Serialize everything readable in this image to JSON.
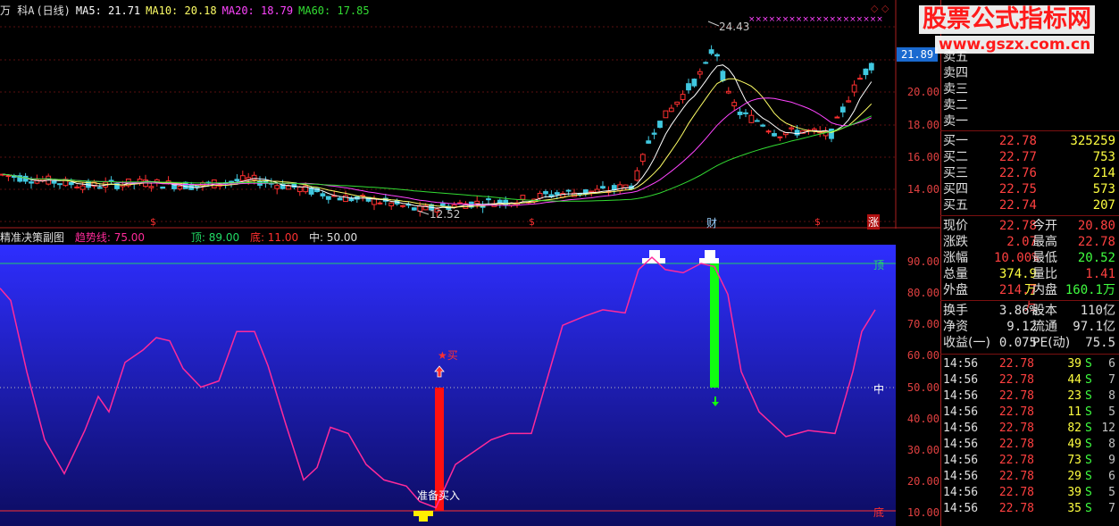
{
  "header": {
    "stock_name": "万 科A",
    "period": "(日线)",
    "ma5": "MA5: 21.71",
    "ma10": "MA10: 20.18",
    "ma20": "MA20: 18.79",
    "ma60": "MA60: 17.85"
  },
  "main_chart": {
    "high_label": "24.43",
    "low_label": "12.52",
    "current_price_tag": "21.89",
    "axis_labels": [
      "20.00",
      "18.00",
      "16.00",
      "14.00"
    ],
    "markers": [
      "$",
      "$",
      "财",
      "$",
      "涨"
    ]
  },
  "sub_chart": {
    "title": "精准决策副图",
    "trend_label": "趋势线: 75.00",
    "top_label": "顶: 89.00",
    "bottom_label": "底: 11.00",
    "mid_label": "中: 50.00",
    "right_top": "顶",
    "right_mid": "中",
    "right_bottom": "底",
    "buy_label": "★买",
    "prepare_buy": "准备买入",
    "axis_labels": [
      "90.00",
      "80.00",
      "70.00",
      "60.00",
      "50.00",
      "40.00",
      "30.00",
      "20.00",
      "10.00"
    ],
    "colors": {
      "bg_top": "#2a2aff",
      "bg_bottom": "#0a0a5a",
      "trend": "#ff2a9a",
      "buy_bar": "#ff1010",
      "sell_bar": "#10ff10",
      "top_line": "#22cc66",
      "bottom_line": "#ff3030"
    }
  },
  "watermark": {
    "title": "股票公式指标网",
    "url": "www.gszx.com.cn"
  },
  "order_book": {
    "sells": [
      {
        "label": "卖五",
        "price": "",
        "vol": ""
      },
      {
        "label": "卖四",
        "price": "",
        "vol": ""
      },
      {
        "label": "卖三",
        "price": "",
        "vol": ""
      },
      {
        "label": "卖二",
        "price": "",
        "vol": ""
      },
      {
        "label": "卖一",
        "price": "",
        "vol": ""
      }
    ],
    "buys": [
      {
        "label": "买一",
        "price": "22.78",
        "vol": "325259"
      },
      {
        "label": "买二",
        "price": "22.77",
        "vol": "753"
      },
      {
        "label": "买三",
        "price": "22.76",
        "vol": "214"
      },
      {
        "label": "买四",
        "price": "22.75",
        "vol": "573"
      },
      {
        "label": "买五",
        "price": "22.74",
        "vol": "207"
      }
    ]
  },
  "quote": [
    {
      "k1": "现价",
      "v1": "22.78",
      "k2": "今开",
      "v2": "20.80"
    },
    {
      "k1": "涨跌",
      "v1": "2.07",
      "k2": "最高",
      "v2": "22.78"
    },
    {
      "k1": "涨幅",
      "v1": "10.00%",
      "k2": "最低",
      "v2": "20.52"
    },
    {
      "k1": "总量",
      "v1": "374.9万",
      "k2": "量比",
      "v2": "1.41"
    },
    {
      "k1": "外盘",
      "v1": "214.7万",
      "k2": "内盘",
      "v2": "160.1万"
    }
  ],
  "quote2": [
    {
      "k1": "换手",
      "v1": "3.86%",
      "k2": "股本",
      "v2": "110亿"
    },
    {
      "k1": "净资",
      "v1": "9.12",
      "k2": "流通",
      "v2": "97.1亿"
    },
    {
      "k1": "收益(一)",
      "v1": "0.075",
      "k2": "PE(动)",
      "v2": "75.5"
    }
  ],
  "ticks": [
    {
      "time": "14:56",
      "price": "22.78",
      "vol": "39",
      "side": "S",
      "num": "6"
    },
    {
      "time": "14:56",
      "price": "22.78",
      "vol": "44",
      "side": "S",
      "num": "7"
    },
    {
      "time": "14:56",
      "price": "22.78",
      "vol": "23",
      "side": "S",
      "num": "8"
    },
    {
      "time": "14:56",
      "price": "22.78",
      "vol": "11",
      "side": "S",
      "num": "5"
    },
    {
      "time": "14:56",
      "price": "22.78",
      "vol": "82",
      "side": "S",
      "num": "12"
    },
    {
      "time": "14:56",
      "price": "22.78",
      "vol": "49",
      "side": "S",
      "num": "8"
    },
    {
      "time": "14:56",
      "price": "22.78",
      "vol": "73",
      "side": "S",
      "num": "9"
    },
    {
      "time": "14:56",
      "price": "22.78",
      "vol": "29",
      "side": "S",
      "num": "6"
    },
    {
      "time": "14:56",
      "price": "22.78",
      "vol": "39",
      "side": "S",
      "num": "5"
    },
    {
      "time": "14:56",
      "price": "22.78",
      "vol": "35",
      "side": "S",
      "num": "7"
    }
  ]
}
